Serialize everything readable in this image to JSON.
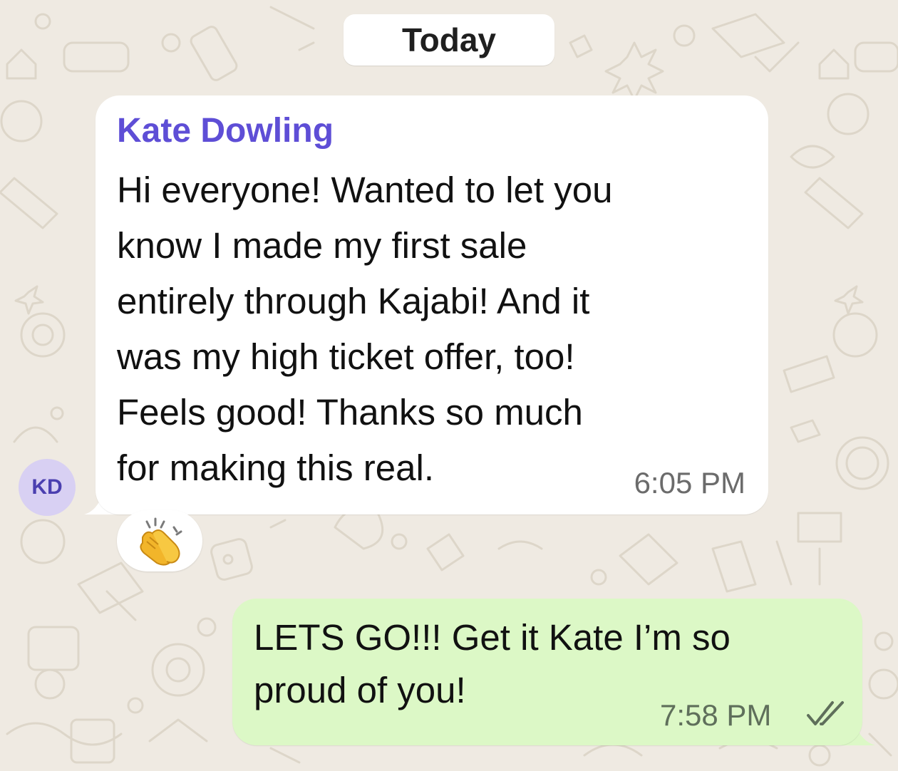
{
  "date_separator": "Today",
  "incoming": {
    "sender": "Kate Dowling",
    "avatar_initials": "KD",
    "avatar_color": "#d8d0f3",
    "sender_color": "#5e4ed6",
    "lines": [
      "Hi everyone! Wanted to let you",
      "know I made my first sale",
      "entirely through Kajabi! And it",
      "was my high ticket offer, too!",
      "Feels good! Thanks so much",
      "for making this real."
    ],
    "time": "6:05 PM",
    "reaction_icon": "clapping-hands-icon"
  },
  "outgoing": {
    "lines": [
      "LETS GO!!! Get it Kate I’m so",
      "proud of you!"
    ],
    "time": "7:58 PM",
    "status_icon": "double-check-icon",
    "bubble_color": "#dcf8c6"
  },
  "background_color": "#efeae2"
}
